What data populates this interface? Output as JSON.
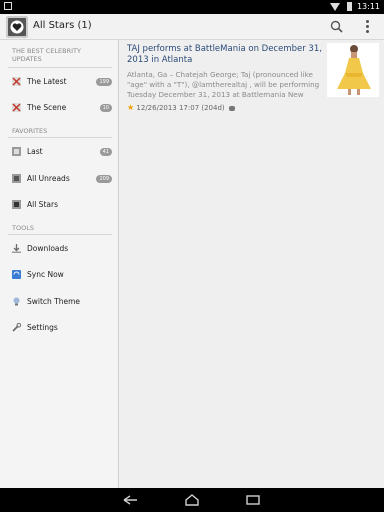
{
  "status_bar": {
    "time": "13:11"
  },
  "action_bar": {
    "title": "All Stars (1)"
  },
  "drawer": {
    "sections": [
      {
        "header": "THE BEST CELEBRITY UPDATES"
      },
      {
        "header": "FAVORITES"
      },
      {
        "header": "TOOLS"
      }
    ],
    "items": [
      {
        "label": "The Latest",
        "count": "199"
      },
      {
        "label": "The Scene",
        "count": "10"
      },
      {
        "label": "Last",
        "count": "41"
      },
      {
        "label": "All Unreads",
        "count": "209"
      },
      {
        "label": "All Stars",
        "count": ""
      },
      {
        "label": "Downloads",
        "count": ""
      },
      {
        "label": "Sync Now",
        "count": ""
      },
      {
        "label": "Switch Theme",
        "count": ""
      },
      {
        "label": "Settings",
        "count": ""
      }
    ]
  },
  "article": {
    "title": "TAJ performs at BattleMania on December 31, 2013 in Atlanta",
    "snippet": "Atlanta, Ga – Chatejah George; Taj (pronounced like \"age\" with a \"T\"), @lamtherealtaj , will be performing Tuesday December 31, 2013 at Battlemania New",
    "meta": "12/26/2013 17:07 (204d)"
  },
  "colors": {
    "accent_link": "#2b4b78",
    "star": "#f0a000",
    "badge": "#9a9a9a"
  }
}
